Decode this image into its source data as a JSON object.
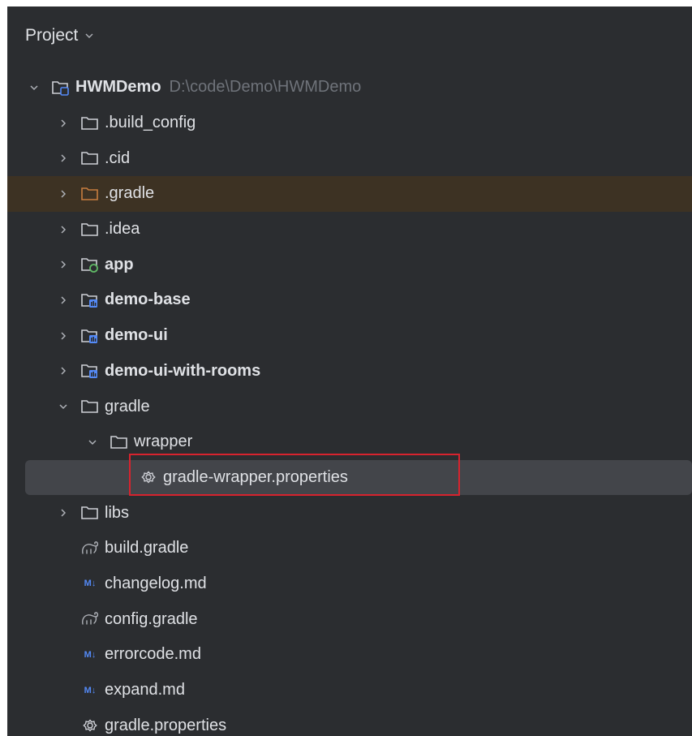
{
  "panel": {
    "title": "Project",
    "title_icon": "chevron-down-icon"
  },
  "tree": {
    "root": {
      "label": "HWMDemo",
      "path": "D:\\code\\Demo\\HWMDemo",
      "icon": "module-folder-icon"
    },
    "items": [
      {
        "label": ".build_config",
        "icon": "folder-icon",
        "expanded": false
      },
      {
        "label": ".cid",
        "icon": "folder-icon",
        "expanded": false
      },
      {
        "label": ".gradle",
        "icon": "folder-orange-icon",
        "expanded": false
      },
      {
        "label": ".idea",
        "icon": "folder-icon",
        "expanded": false
      },
      {
        "label": "app",
        "icon": "app-module-icon",
        "expanded": false
      },
      {
        "label": "demo-base",
        "icon": "library-module-icon",
        "expanded": false
      },
      {
        "label": "demo-ui",
        "icon": "library-module-icon",
        "expanded": false
      },
      {
        "label": "demo-ui-with-rooms",
        "icon": "library-module-icon",
        "expanded": false
      },
      {
        "label": "gradle",
        "icon": "folder-icon",
        "expanded": true
      },
      {
        "label": "wrapper",
        "icon": "folder-icon",
        "expanded": true
      },
      {
        "label": "gradle-wrapper.properties",
        "icon": "gear-icon",
        "selected": true
      },
      {
        "label": "libs",
        "icon": "folder-icon",
        "expanded": false
      },
      {
        "label": "build.gradle",
        "icon": "gradle-elephant-icon"
      },
      {
        "label": "changelog.md",
        "icon": "markdown-icon",
        "badge": "M↓"
      },
      {
        "label": "config.gradle",
        "icon": "gradle-elephant-icon"
      },
      {
        "label": "errorcode.md",
        "icon": "markdown-icon",
        "badge": "M↓"
      },
      {
        "label": "expand.md",
        "icon": "markdown-icon",
        "badge": "M↓"
      },
      {
        "label": "gradle.properties",
        "icon": "gear-icon"
      }
    ]
  },
  "colors": {
    "background": "#2b2d30",
    "text": "#dfe1e5",
    "path_text": "#6f737a",
    "orange_row": "#3d3223",
    "selected_row": "#43454a",
    "highlight_border": "#d7232e",
    "module_blue": "#548af7",
    "app_green": "#5fb865",
    "gradle_orange": "#c77d3f"
  }
}
